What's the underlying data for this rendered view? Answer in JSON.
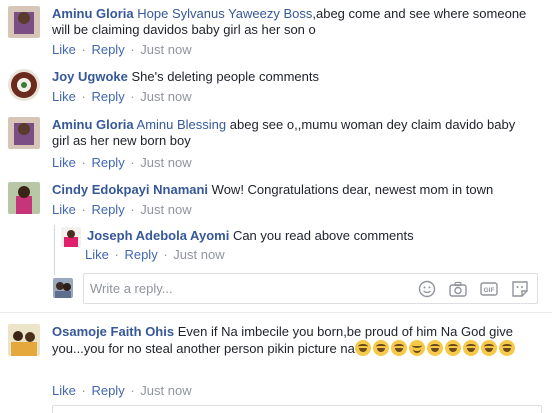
{
  "actions": {
    "like": "Like",
    "reply": "Reply",
    "time": "Just now",
    "separator": "·"
  },
  "comments": [
    {
      "author": "Aminu Gloria",
      "tag": "Hope Sylvanus Yaweezy Boss",
      "text": ",abeg come and see where someone will be claiming davidos baby girl as her son o"
    },
    {
      "author": "Joy Ugwoke",
      "tag": "",
      "text": "She's deleting people comments"
    },
    {
      "author": "Aminu Gloria",
      "tag": "Aminu Blessing",
      "text": "abeg see o,,mumu woman dey claim davido baby girl as her new born boy"
    },
    {
      "author": "Cindy Edokpayi Nnamani",
      "tag": "",
      "text": "Wow! Congratulations dear, newest mom in town"
    },
    {
      "author": "Osamoje Faith Ohis",
      "tag": "",
      "text": "Even if Na imbecile you born,be proud of him Na God give you...you for no steal another person pikin picture na"
    }
  ],
  "reply": {
    "author": "Joseph Adebola Ayomi",
    "text": "Can you read above comments"
  },
  "reply_box": {
    "placeholder": "Write a reply...",
    "icons": [
      "emoji-icon",
      "camera-icon",
      "gif-icon",
      "sticker-icon"
    ]
  },
  "colors": {
    "link": "#365899",
    "action": "#4267b2",
    "muted": "#90949c",
    "text": "#1d2129"
  }
}
